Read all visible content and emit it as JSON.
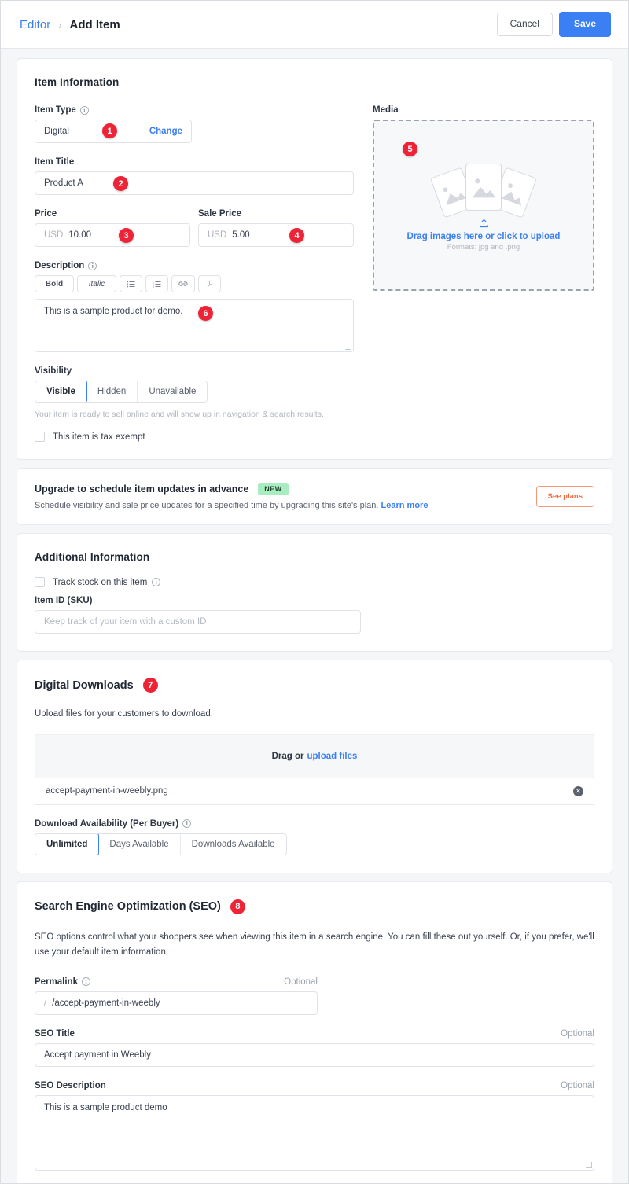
{
  "header": {
    "breadcrumb_root": "Editor",
    "breadcrumb_sep": "›",
    "breadcrumb_current": "Add Item",
    "cancel_label": "Cancel",
    "save_label": "Save"
  },
  "item_information": {
    "section_title": "Item Information",
    "item_type": {
      "label": "Item Type",
      "value": "Digital",
      "change_label": "Change",
      "badge": "1"
    },
    "item_title": {
      "label": "Item Title",
      "value": "Product A",
      "badge": "2"
    },
    "price": {
      "label": "Price",
      "currency": "USD",
      "value": "10.00",
      "badge": "3"
    },
    "sale_price": {
      "label": "Sale Price",
      "currency": "USD",
      "value": "5.00",
      "badge": "4"
    },
    "description": {
      "label": "Description",
      "toolbar": [
        "Bold",
        "Italic",
        "☰",
        "☷",
        "🔗",
        "✐"
      ],
      "value": "This is a sample product for demo.",
      "badge": "6"
    },
    "visibility": {
      "label": "Visibility",
      "options": [
        "Visible",
        "Hidden",
        "Unavailable"
      ],
      "selected": "Visible",
      "helper": "Your item is ready to sell online and will show up in navigation & search results."
    },
    "tax_exempt": {
      "label": "This item is tax exempt",
      "checked": false
    },
    "media": {
      "label": "Media",
      "drop_text": "Drag images here or click to upload",
      "formats": "Formats: jpg and .png",
      "badge": "5"
    }
  },
  "upgrade_banner": {
    "title": "Upgrade to schedule item updates in advance",
    "badge": "NEW",
    "subtitle_before": "Schedule visibility and sale price updates for a specified time by upgrading this site's plan.",
    "learn_more": "Learn more",
    "cta_label": "See plans"
  },
  "additional_information": {
    "section_title": "Additional Information",
    "track_stock_label": "Track stock on this item",
    "sku_label": "Item ID (SKU)",
    "sku_placeholder": "Keep track of your item with a custom ID"
  },
  "digital_downloads": {
    "section_title": "Digital Downloads",
    "badge": "7",
    "subtitle": "Upload files for your customers to download.",
    "drop_prefix": "Drag or",
    "drop_link": "upload files",
    "file_name": "accept-payment-in-weebly.png",
    "availability": {
      "label": "Download Availability (Per Buyer)",
      "options": [
        "Unlimited",
        "Days Available",
        "Downloads Available"
      ],
      "selected": "Unlimited"
    }
  },
  "seo": {
    "section_title": "Search Engine Optimization (SEO)",
    "badge": "8",
    "description": "SEO options control what your shoppers see when viewing this item in a search engine. You can fill these out yourself. Or, if you prefer, we'll use your default item information.",
    "permalink": {
      "label": "Permalink",
      "optional": "Optional",
      "prefix": "/",
      "value": "/accept-payment-in-weebly"
    },
    "seo_title": {
      "label": "SEO Title",
      "optional": "Optional",
      "value": "Accept payment in Weebly"
    },
    "seo_description": {
      "label": "SEO Description",
      "optional": "Optional",
      "value": "This is a sample product demo"
    }
  },
  "colors": {
    "accent_blue": "#3b7ff5",
    "badge_red": "#ee2436",
    "badge_green": "#a8edc0",
    "cta_orange": "#f26b3f"
  }
}
